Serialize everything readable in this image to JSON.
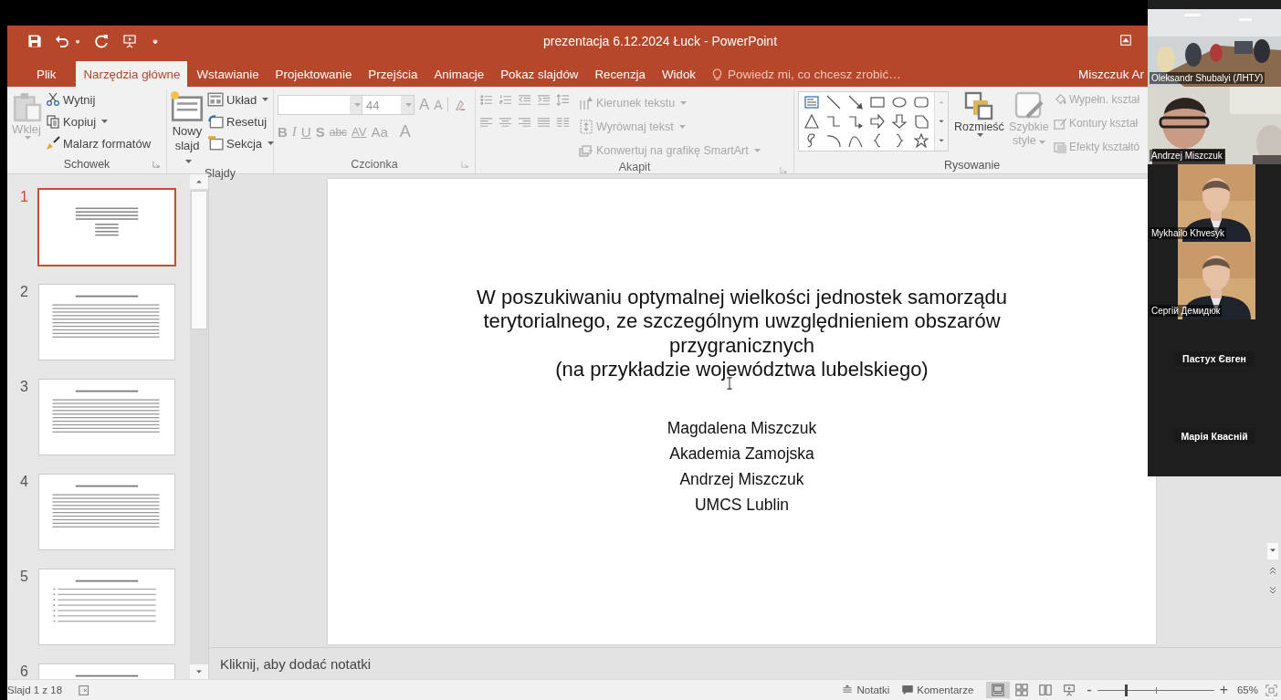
{
  "title_bar": {
    "title": "prezentacja 6.12.2024 Łuck - PowerPoint"
  },
  "tabs": [
    {
      "label": "Plik",
      "selected": false
    },
    {
      "label": "Narzędzia główne",
      "selected": true
    },
    {
      "label": "Wstawianie",
      "selected": false
    },
    {
      "label": "Projektowanie",
      "selected": false
    },
    {
      "label": "Przejścia",
      "selected": false
    },
    {
      "label": "Animacje",
      "selected": false
    },
    {
      "label": "Pokaz slajdów",
      "selected": false
    },
    {
      "label": "Recenzja",
      "selected": false
    },
    {
      "label": "Widok",
      "selected": false
    }
  ],
  "tell_me": {
    "placeholder": "Powiedz mi, co chcesz zrobić…"
  },
  "account": {
    "name": "Miszczuk Ar"
  },
  "clipboard": {
    "label": "Schowek",
    "launcher": true,
    "paste": {
      "label": "Wklej",
      "disabled": true
    },
    "commands": [
      {
        "label": "Wytnij",
        "dropdown": false
      },
      {
        "label": "Kopiuj",
        "dropdown": true
      },
      {
        "label": "Malarz formatów",
        "dropdown": false
      }
    ]
  },
  "slides_group": {
    "label": "Slajdy",
    "launcher": false,
    "new_slide": {
      "label": "Nowy slajd",
      "dropdown": true
    },
    "commands": [
      {
        "label": "Układ",
        "dropdown": true
      },
      {
        "label": "Resetuj",
        "dropdown": false
      },
      {
        "label": "Sekcja",
        "dropdown": true
      }
    ]
  },
  "font_group": {
    "label": "Czcionka",
    "launcher": true,
    "disabled": true,
    "font_size": "44",
    "size_buttons": [
      "A",
      "A"
    ],
    "format_buttons": [
      "B",
      "I",
      "U",
      "S",
      "abc",
      "AV",
      "Aa",
      "A"
    ]
  },
  "paragraph_group": {
    "label": "Akapit",
    "launcher": true,
    "disabled": true,
    "commands": [
      {
        "label": "Kierunek tekstu",
        "dropdown": true
      },
      {
        "label": "Wyrównaj tekst",
        "dropdown": true
      },
      {
        "label": "Konwertuj na grafikę SmartArt",
        "dropdown": true
      }
    ]
  },
  "drawing_group": {
    "label": "Rysowanie",
    "arrange": {
      "label": "Rozmieść",
      "disabled": false
    },
    "quick_styles": {
      "label": "Szybkie style",
      "disabled": true
    },
    "shape_commands": [
      {
        "label": "Wypełn. kształ",
        "disabled": true
      },
      {
        "label": "Kontury kształ",
        "disabled": true
      },
      {
        "label": "Efekty kształtó",
        "disabled": true
      }
    ]
  },
  "thumbnails": [
    {
      "number": "1",
      "selected": true,
      "kind": "title"
    },
    {
      "number": "2",
      "selected": false,
      "kind": "text"
    },
    {
      "number": "3",
      "selected": false,
      "kind": "text"
    },
    {
      "number": "4",
      "selected": false,
      "kind": "text"
    },
    {
      "number": "5",
      "selected": false,
      "kind": "bullets"
    },
    {
      "number": "6",
      "selected": false,
      "kind": "text"
    }
  ],
  "slide": {
    "title_lines": [
      "W poszukiwaniu optymalnej wielkości jednostek samorządu",
      "terytorialnego, ze szczególnym uwzględnieniem obszarów",
      "przygranicznych",
      "(na przykładzie województwa lubelskiego)"
    ],
    "authors": [
      "Magdalena Miszczuk",
      "Akademia Zamojska",
      "Andrzej Miszczuk",
      "UMCS Lublin"
    ]
  },
  "notes": {
    "text": "Kliknij, aby dodać notatki"
  },
  "status_bar": {
    "slide_info": "Slajd 1 z 18",
    "notes_button": "Notatki",
    "comments_button": "Komentarze",
    "view_buttons": [
      {
        "selected": true
      },
      {
        "selected": false
      },
      {
        "selected": false
      },
      {
        "selected": false
      }
    ],
    "zoom": {
      "minus": "-",
      "plus": "+",
      "level": 0.24,
      "reading": "65%"
    }
  },
  "participants": [
    {
      "name": "Oleksandr Shubalyi (ЛНТУ)",
      "kind": "room"
    },
    {
      "name": "Andrzej Miszczuk",
      "kind": "person"
    },
    {
      "name": "Mykhailo Khvesyk",
      "kind": "portrait"
    },
    {
      "name": "Сергій Демидюк",
      "kind": "portrait"
    },
    {
      "name": "Пастух Євген",
      "kind": "off"
    },
    {
      "name": "Марія Квасній",
      "kind": "off"
    }
  ]
}
